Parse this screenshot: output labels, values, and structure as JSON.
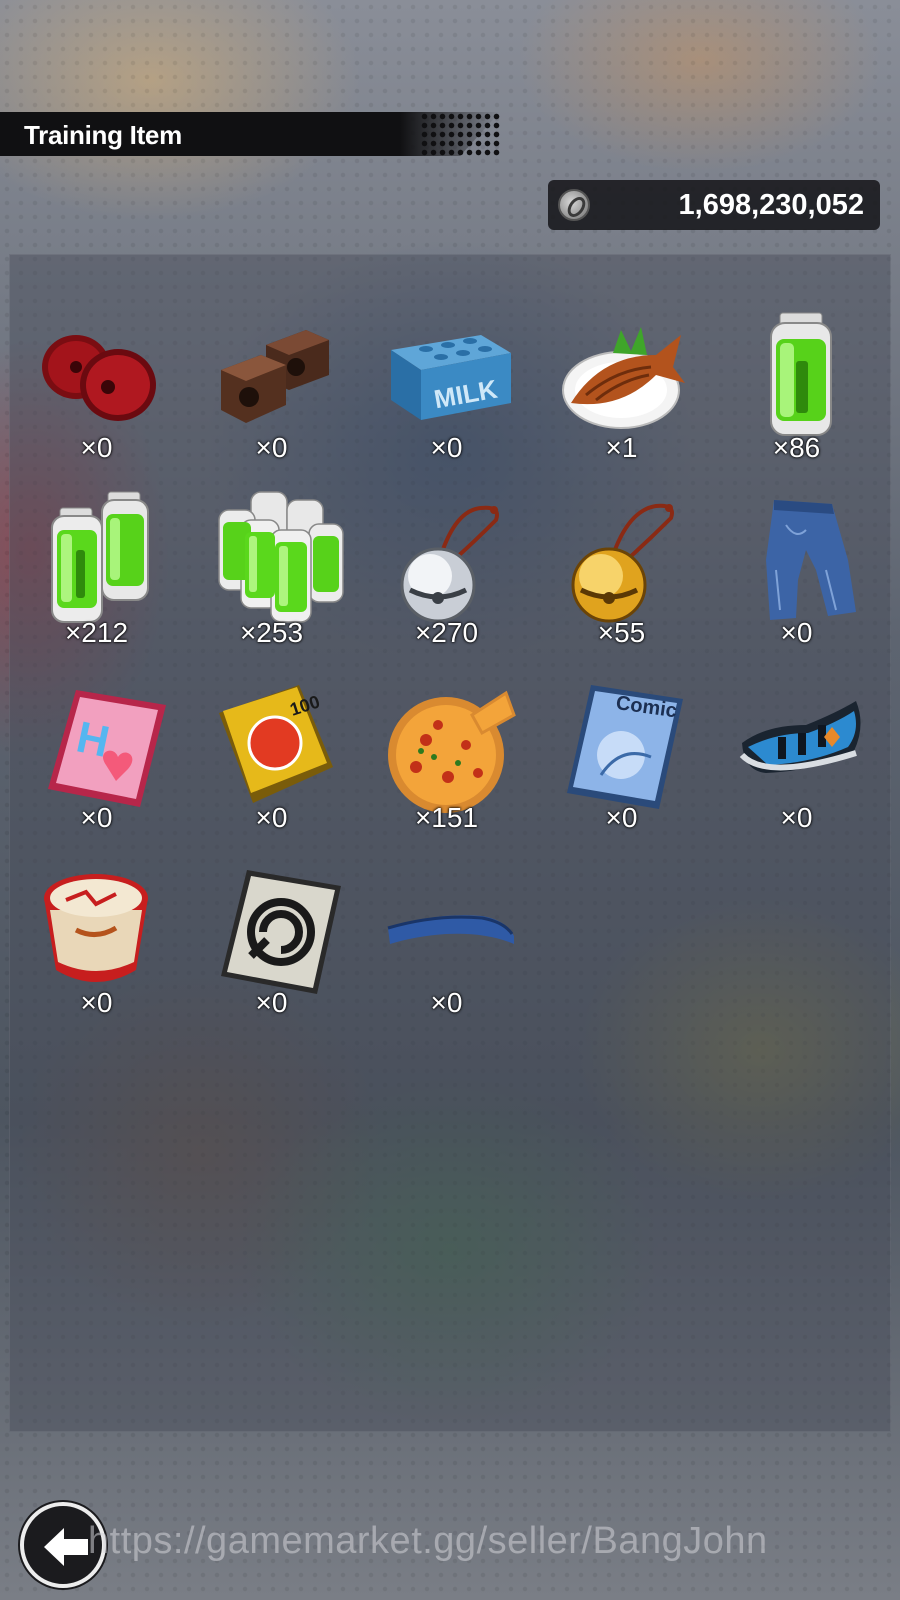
{
  "header": {
    "title": "Training Item"
  },
  "currency": {
    "icon": "zeni-coin-icon",
    "value": "1,698,230,052"
  },
  "items": [
    {
      "name": "red-weights",
      "count": "×0"
    },
    {
      "name": "brick-weights",
      "count": "×0"
    },
    {
      "name": "milk-carton",
      "count": "×0",
      "label": "MILK"
    },
    {
      "name": "grilled-fish",
      "count": "×1"
    },
    {
      "name": "energy-battery-single",
      "count": "×86"
    },
    {
      "name": "energy-battery-double",
      "count": "×212"
    },
    {
      "name": "energy-battery-pack",
      "count": "×253"
    },
    {
      "name": "silver-bell",
      "count": "×270"
    },
    {
      "name": "gold-bell",
      "count": "×55"
    },
    {
      "name": "jeans",
      "count": "×0"
    },
    {
      "name": "magazine-h",
      "count": "×0",
      "label": "H"
    },
    {
      "name": "joke-book",
      "count": "×0",
      "label": "100"
    },
    {
      "name": "pizza",
      "count": "×151"
    },
    {
      "name": "comic-book",
      "count": "×0",
      "label": "Comic"
    },
    {
      "name": "sneaker",
      "count": "×0"
    },
    {
      "name": "ramen-cup",
      "count": "×0"
    },
    {
      "name": "symbol-card",
      "count": "×0"
    },
    {
      "name": "blue-cloth",
      "count": "×0"
    }
  ],
  "footer": {
    "back_icon": "back-arrow-icon",
    "watermark": "https://gamemarket.gg/seller/BangJohn"
  },
  "colors": {
    "title_bar": "#101012",
    "currency_bg": "#1b1b1e",
    "text": "#ffffff"
  }
}
